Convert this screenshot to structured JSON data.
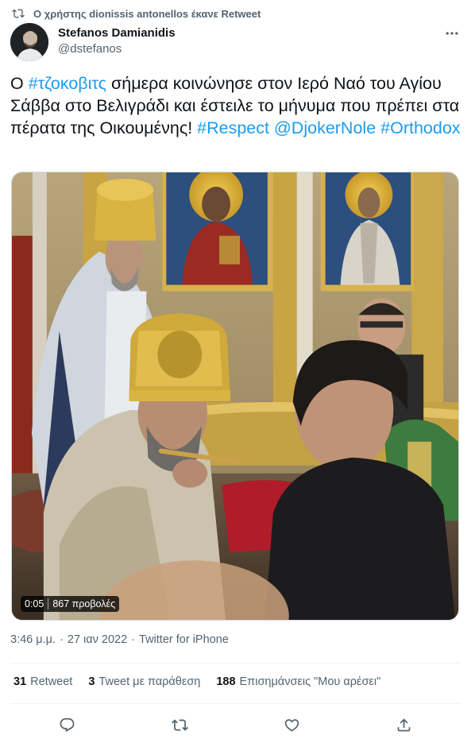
{
  "retweet_banner": {
    "text": "Ο χρήστης dionissis antonellos έκανε Retweet"
  },
  "author": {
    "display_name": "Stefanos Damianidis",
    "handle": "@dstefanos"
  },
  "tweet": {
    "segments": [
      {
        "text": "Ο ",
        "type": "text"
      },
      {
        "text": "#τζοκοβιτς",
        "type": "hashtag"
      },
      {
        "text": " σήμερα κοινώνησε στον Ιερό Ναό του Αγίου Σάββα  στο Βελιγράδι και έστειλε το μήνυμα που πρέπει στα πέρατα της Οικουμένης! ",
        "type": "text"
      },
      {
        "text": "#Respect",
        "type": "hashtag"
      },
      {
        "text": " ",
        "type": "text"
      },
      {
        "text": "@DjokerNole",
        "type": "mention"
      },
      {
        "text": " ",
        "type": "text"
      },
      {
        "text": "#Orthodox",
        "type": "hashtag"
      }
    ]
  },
  "media": {
    "duration": "0:05",
    "views": "867 προβολές"
  },
  "meta": {
    "time": "3:46 μ.μ.",
    "date": "27 ιαν 2022",
    "source": "Twitter for iPhone",
    "separator": "·"
  },
  "stats": {
    "retweets": {
      "count": "31",
      "label": "Retweet"
    },
    "quotes": {
      "count": "3",
      "label": "Tweet με παράθεση"
    },
    "likes": {
      "count": "188",
      "label": "Επισημάνσεις \"Μου αρέσει\""
    }
  },
  "colors": {
    "accent": "#1d9bf0",
    "secondary_text": "#536471",
    "primary_text": "#0f1419",
    "divider": "#eff3f4"
  },
  "icons": {
    "retweet_banner": "retweet-icon",
    "more": "more-horizontal-icon",
    "reply": "reply-icon",
    "retweet": "retweet-icon",
    "like": "heart-icon",
    "share": "share-icon"
  }
}
